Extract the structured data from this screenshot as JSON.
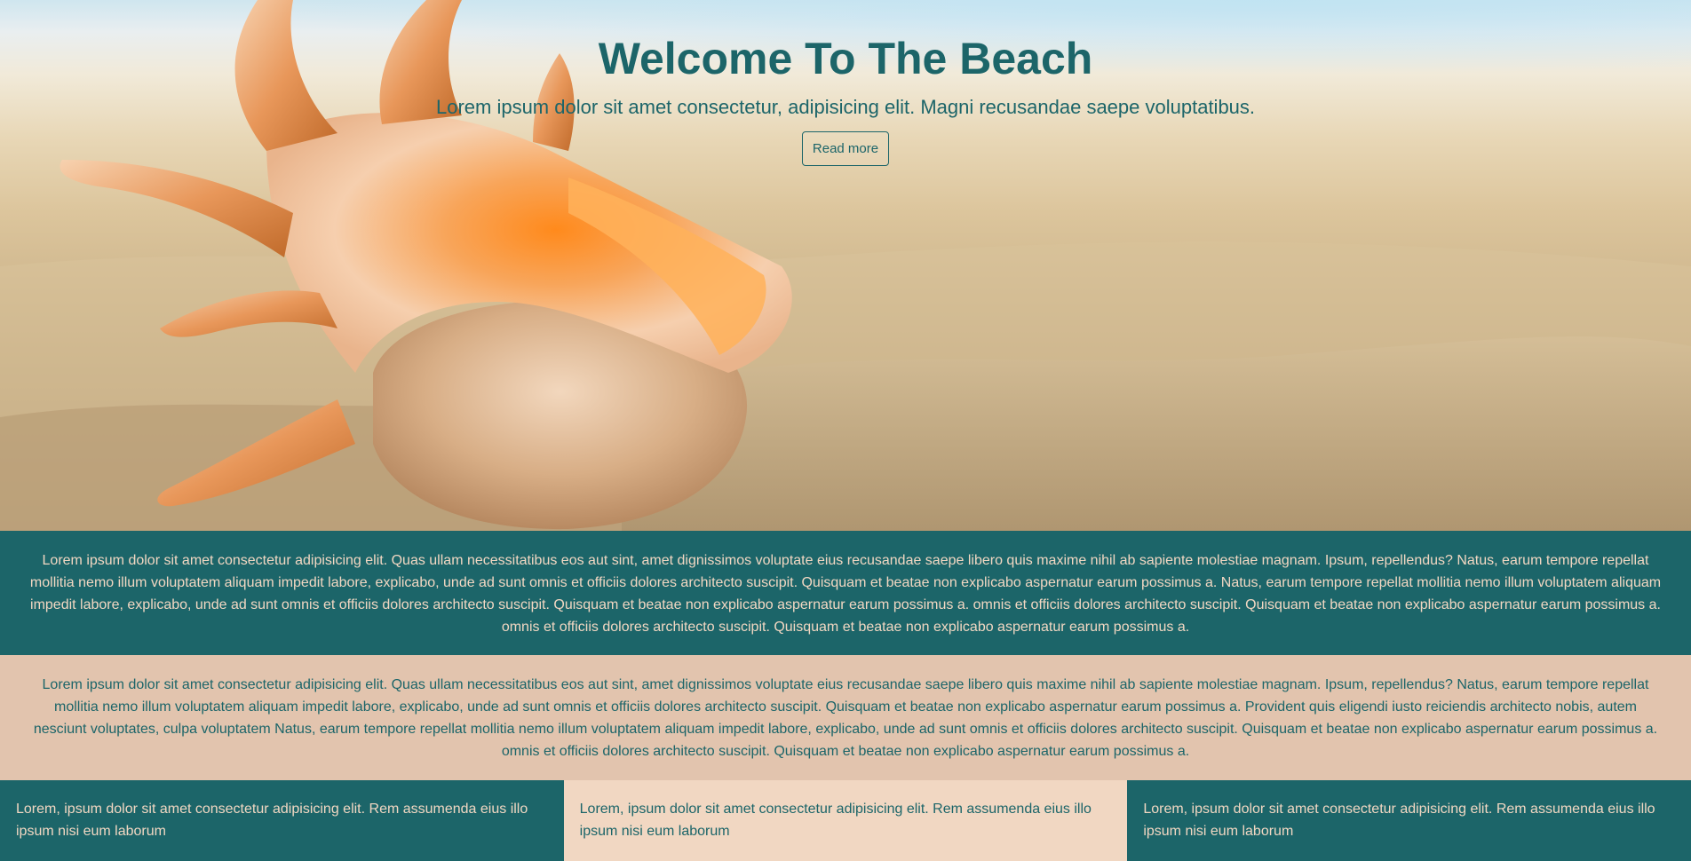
{
  "hero": {
    "title": "Welcome To The Beach",
    "subtitle": "Lorem ipsum dolor sit amet consectetur, adipisicing elit. Magni recusandae saepe voluptatibus.",
    "button_label": "Read more"
  },
  "section_one": {
    "text": "Lorem ipsum dolor sit amet consectetur adipisicing elit. Quas ullam necessitatibus eos aut sint, amet dignissimos voluptate eius recusandae saepe libero quis maxime nihil ab sapiente molestiae magnam. Ipsum, repellendus? Natus, earum tempore repellat mollitia nemo illum voluptatem aliquam impedit labore, explicabo, unde ad sunt omnis et officiis dolores architecto suscipit. Quisquam et beatae non explicabo aspernatur earum possimus a. Natus, earum tempore repellat mollitia nemo illum voluptatem aliquam impedit labore, explicabo, unde ad sunt omnis et officiis dolores architecto suscipit. Quisquam et beatae non explicabo aspernatur earum possimus a. omnis et officiis dolores architecto suscipit. Quisquam et beatae non explicabo aspernatur earum possimus a. omnis et officiis dolores architecto suscipit. Quisquam et beatae non explicabo aspernatur earum possimus a."
  },
  "section_two": {
    "text": "Lorem ipsum dolor sit amet consectetur adipisicing elit. Quas ullam necessitatibus eos aut sint, amet dignissimos voluptate eius recusandae saepe libero quis maxime nihil ab sapiente molestiae magnam. Ipsum, repellendus? Natus, earum tempore repellat mollitia nemo illum voluptatem aliquam impedit labore, explicabo, unde ad sunt omnis et officiis dolores architecto suscipit. Quisquam et beatae non explicabo aspernatur earum possimus a. Provident quis eligendi iusto reiciendis architecto nobis, autem nesciunt voluptates, culpa voluptatem Natus, earum tempore repellat mollitia nemo illum voluptatem aliquam impedit labore, explicabo, unde ad sunt omnis et officiis dolores architecto suscipit. Quisquam et beatae non explicabo aspernatur earum possimus a. omnis et officiis dolores architecto suscipit. Quisquam et beatae non explicabo aspernatur earum possimus a."
  },
  "columns": [
    {
      "text": "Lorem, ipsum dolor sit amet consectetur adipisicing elit. Rem assumenda eius illo ipsum nisi eum laborum"
    },
    {
      "text": "Lorem, ipsum dolor sit amet consectetur adipisicing elit. Rem assumenda eius illo ipsum nisi eum laborum"
    },
    {
      "text": "Lorem, ipsum dolor sit amet consectetur adipisicing elit. Rem assumenda eius illo ipsum nisi eum laborum"
    }
  ],
  "colors": {
    "teal": "#1c6569",
    "sand": "#e2c4ae",
    "light_sand": "#f1d7c2"
  },
  "hero_image": {
    "icon": "seashell-on-sand-image"
  }
}
